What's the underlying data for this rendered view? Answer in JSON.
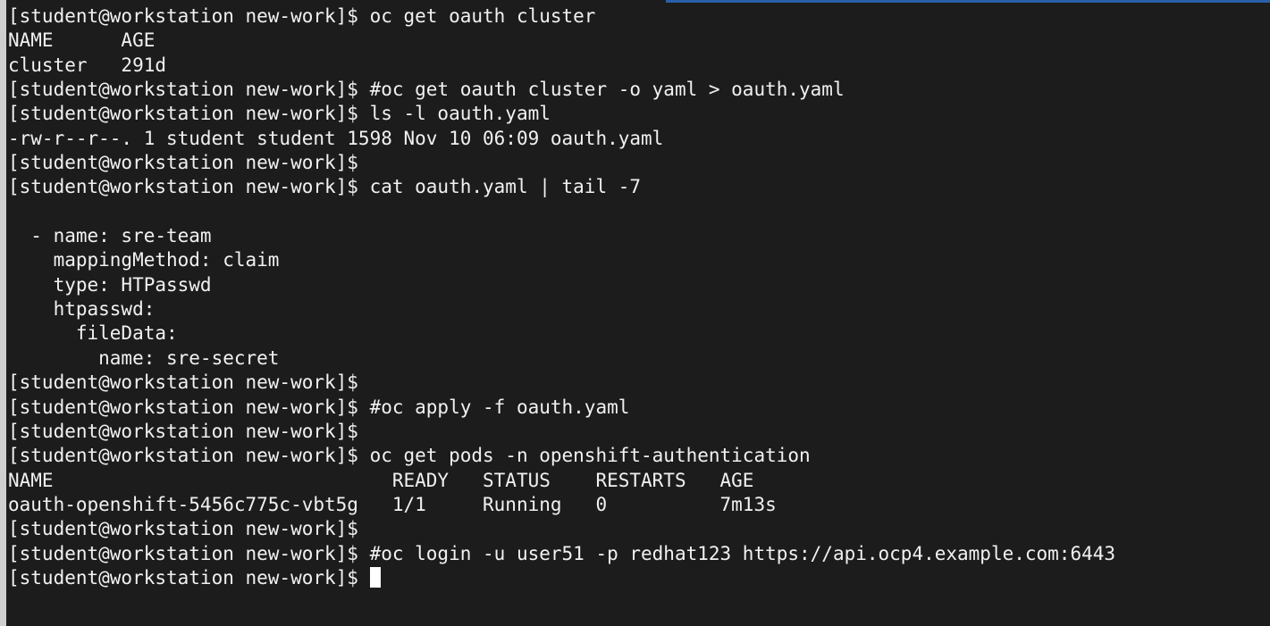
{
  "accent_colors": {
    "top_bar": "#2a5ea8",
    "left_edge": "#cfcfcf",
    "background": "#1c1c1c",
    "text": "#f1f1f1"
  },
  "terminal": {
    "lines": [
      "[student@workstation new-work]$ oc get oauth cluster",
      "NAME      AGE",
      "cluster   291d",
      "[student@workstation new-work]$ #oc get oauth cluster -o yaml > oauth.yaml",
      "[student@workstation new-work]$ ls -l oauth.yaml",
      "-rw-r--r--. 1 student student 1598 Nov 10 06:09 oauth.yaml",
      "[student@workstation new-work]$",
      "[student@workstation new-work]$ cat oauth.yaml | tail -7",
      "",
      "  - name: sre-team",
      "    mappingMethod: claim",
      "    type: HTPasswd",
      "    htpasswd:",
      "      fileData:",
      "        name: sre-secret",
      "[student@workstation new-work]$",
      "[student@workstation new-work]$ #oc apply -f oauth.yaml",
      "[student@workstation new-work]$",
      "[student@workstation new-work]$ oc get pods -n openshift-authentication",
      "NAME                              READY   STATUS    RESTARTS   AGE",
      "oauth-openshift-5456c775c-vbt5g   1/1     Running   0          7m13s",
      "[student@workstation new-work]$",
      "[student@workstation new-work]$ #oc login -u user51 -p redhat123 https://api.ocp4.example.com:6443",
      "[student@workstation new-work]$ "
    ]
  }
}
